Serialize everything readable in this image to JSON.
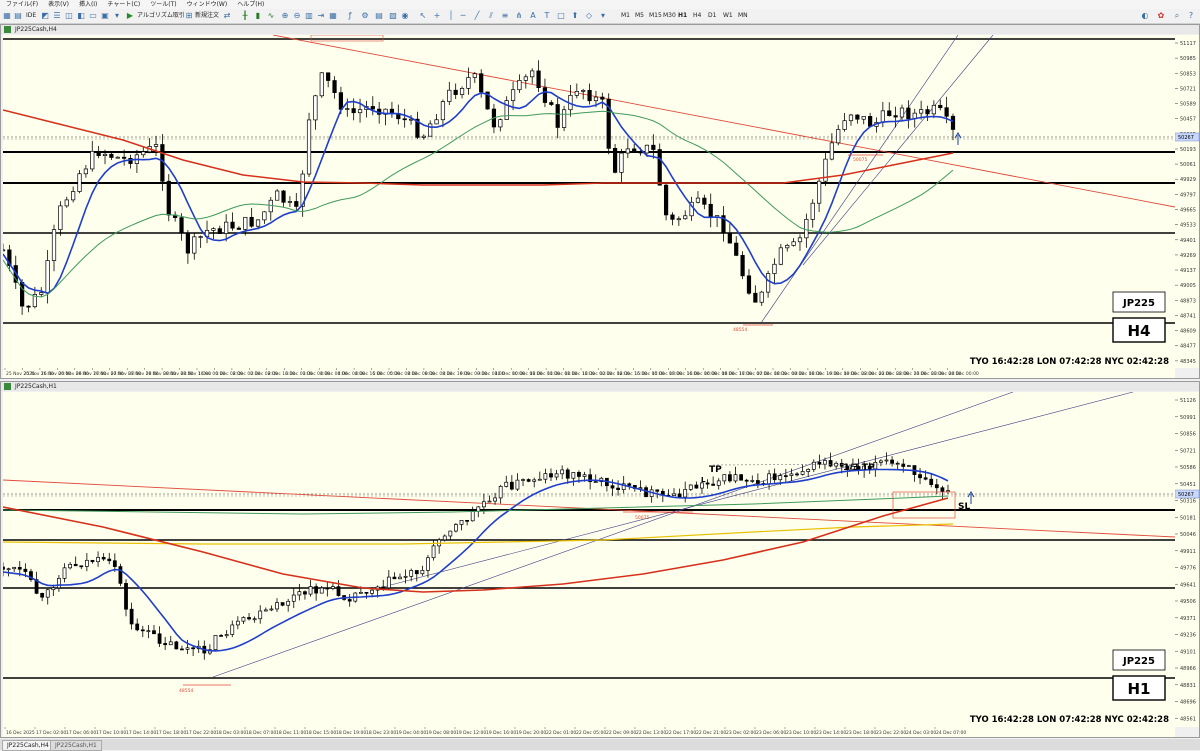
{
  "menu": [
    "ファイル(F)",
    "表示(V)",
    "挿入(I)",
    "チャート(C)",
    "ツール(T)",
    "ウィンドウ(W)",
    "ヘルプ(H)"
  ],
  "toolbar": {
    "algo_label": "アルゴリズム取引",
    "new_order_label": "新規注文",
    "ide_label": "IDE",
    "timeframes": [
      "M1",
      "M5",
      "M15",
      "M30",
      "H1",
      "H4",
      "D1",
      "W1",
      "MN"
    ],
    "active_timeframe": "H1"
  },
  "colors": {
    "chart_bg": "#ffffee",
    "ma_blue": "#1e3ecb",
    "ma_red": "#d62f1a",
    "ma_green": "#3f9a5a",
    "ma_yellow": "#e8c000",
    "trend_red": "#e04a3a",
    "channel": "#3a3a80"
  },
  "top_chart": {
    "window_title": "JP225Cash,H4",
    "symbol_label": "JP225",
    "timeframe_label": "H4",
    "clock": "TYO 16:42:28  LON 07:42:28  NYC 02:42:28",
    "price_ticks": [
      "51117",
      "50985",
      "50853",
      "50721",
      "50589",
      "50457",
      "50325",
      "50193",
      "50061",
      "49929",
      "49797",
      "49665",
      "49533",
      "49401",
      "49269",
      "49137",
      "49005",
      "48873",
      "48741",
      "48609",
      "48477",
      "48345"
    ],
    "current_price": "50267",
    "time_ticks": [
      "25 Nov 2025",
      "25 Nov 16:00",
      "26 Nov 00:00",
      "26 Nov 08:00",
      "26 Nov 16:00",
      "27 Nov 00:00",
      "27 Nov 08:00",
      "27 Nov 16:00",
      "28 Nov 00:00",
      "28 Nov 08:00",
      "28 Nov 16:00",
      "1 Dec 00:00",
      "1 Dec 08:00",
      "2 Dec 00:00",
      "2 Dec 08:00",
      "2 Dec 16:00",
      "3 Dec 00:00",
      "3 Dec 08:00",
      "4 Dec 00:00",
      "4 Dec 08:00",
      "4 Dec 16:00",
      "5 Dec 00:00",
      "5 Dec 08:00",
      "8 Dec 00:00",
      "8 Dec 08:00",
      "8 Dec 16:00",
      "9 Dec 00:00",
      "9 Dec 08:00",
      "10 Dec 00:00",
      "10 Dec 08:00",
      "11 Dec 00:00",
      "11 Dec 08:00",
      "11 Dec 16:00",
      "12 Dec 00:00",
      "12 Dec 08:00",
      "12 Dec 16:00",
      "15 Dec 00:00",
      "15 Dec 08:00",
      "15 Dec 16:00",
      "16 Dec 00:00",
      "16 Dec 08:00",
      "16 Dec 16:00",
      "17 Dec 00:00",
      "17 Dec 08:00",
      "18 Dec 00:00",
      "18 Dec 08:00",
      "18 Dec 16:00",
      "19 Dec 00:00",
      "19 Dec 08:00",
      "22 Dec 00:00",
      "22 Dec 08:00",
      "22 Dec 16:00",
      "23 Dec 00:00",
      "23 Dec 08:00",
      "24 Dec 00:00"
    ],
    "low_label": "48554",
    "mid_label": "50075"
  },
  "bottom_chart": {
    "window_title": "JP225Cash,H1",
    "symbol_label": "JP225",
    "timeframe_label": "H1",
    "clock": "TYO 16:42:28  LON 07:42:28  NYC 02:42:28",
    "price_ticks": [
      "51126",
      "50991",
      "50856",
      "50721",
      "50586",
      "50451",
      "50316",
      "50181",
      "50046",
      "49911",
      "49776",
      "49641",
      "49506",
      "49371",
      "49236",
      "49101",
      "48966",
      "48831",
      "48696",
      "48561"
    ],
    "current_price": "50267",
    "time_ticks": [
      "16 Dec 2025",
      "17 Dec 02:00",
      "17 Dec 06:00",
      "17 Dec 10:00",
      "17 Dec 14:00",
      "17 Dec 18:00",
      "17 Dec 22:00",
      "18 Dec 03:00",
      "18 Dec 07:00",
      "18 Dec 11:00",
      "18 Dec 15:00",
      "18 Dec 19:00",
      "18 Dec 23:00",
      "19 Dec 04:00",
      "19 Dec 08:00",
      "19 Dec 12:00",
      "19 Dec 16:00",
      "19 Dec 20:00",
      "22 Dec 01:00",
      "22 Dec 05:00",
      "22 Dec 09:00",
      "22 Dec 13:00",
      "22 Dec 17:00",
      "22 Dec 21:00",
      "23 Dec 02:00",
      "23 Dec 06:00",
      "23 Dec 10:00",
      "23 Dec 14:00",
      "23 Dec 18:00",
      "23 Dec 22:00",
      "24 Dec 03:00",
      "24 Dec 07:00"
    ],
    "tp_label": "TP",
    "l_label": "L",
    "one_third_label": "1/3 TP",
    "sl_label": "SL",
    "low_label": "48554",
    "mid_label": "50075"
  },
  "tabs": [
    "JP225Cash,H4",
    "JP225Cash,H1"
  ]
}
